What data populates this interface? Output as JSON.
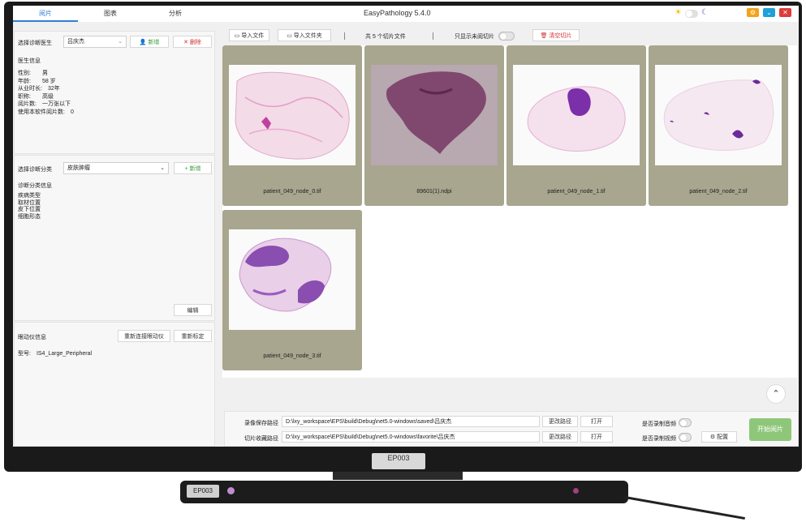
{
  "app": {
    "title": "EasyPathology 5.4.0",
    "tabs": [
      "阅片",
      "图表",
      "分析"
    ]
  },
  "doctor_panel": {
    "select_label": "选择诊断医生",
    "selected_doctor": "吕庆杰",
    "add_label": "新增",
    "delete_label": "删除",
    "section_title": "医生信息",
    "info_lines": [
      "性别:　　男",
      "年龄:　　58 岁",
      "从业时长:　32年",
      "职称:　　高级",
      "阅片数:　一万张以下",
      "使用本软件阅片数:　0"
    ]
  },
  "diagnosis_panel": {
    "select_label": "选择诊断分类",
    "selected_category": "皮肤肿瘤",
    "add_label": "+ 新增",
    "section_title": "诊断分类信息",
    "info_lines": [
      "疾病类型",
      "取材位置",
      "皮下位置",
      "细胞形态"
    ],
    "edit_label": "编辑"
  },
  "eye_tracker_panel": {
    "title": "眼动仪信息",
    "reconnect_label": "重新连接眼动仪",
    "recalibrate_label": "重新标定",
    "model_text": "型号:　IS4_Large_Peripheral"
  },
  "toolbar": {
    "import_file_label": "导入文件",
    "import_folder_label": "导入文件夹",
    "count_text": "共 5 个切片文件",
    "show_unread_label": "只显示未阅切片",
    "clear_label": "清空切片"
  },
  "slides": [
    {
      "name": "patient_049_node_0.tif",
      "color": "#d96fb3"
    },
    {
      "name": "89601(1).ndpi",
      "color": "#7a3c68"
    },
    {
      "name": "patient_049_node_1.tif",
      "color": "#7b2fa8"
    },
    {
      "name": "patient_049_node_2.tif",
      "color": "#6a2a9a"
    },
    {
      "name": "patient_049_node_3.tif",
      "color": "#8a4db0"
    }
  ],
  "bottom": {
    "record_path_label": "录像保存路径",
    "record_path_value": "D:\\lxy_workspace\\EPS\\build\\Debug\\net5.0-windows\\saved\\吕庆杰",
    "favorite_path_label": "切片收藏路径",
    "favorite_path_value": "D:\\lxy_workspace\\EPS\\build\\Debug\\net5.0-windows\\favorite\\吕庆杰",
    "change_path_label": "更改路径",
    "open_label": "打开",
    "record_audio_label": "是否录制音频",
    "record_video_label": "是否录制视频",
    "config_label": "配置",
    "start_label": "开始阅片"
  },
  "device": {
    "monitor_tag": "EP003",
    "bar_tag": "EP003"
  },
  "colors": {
    "accent": "#2f7fd6",
    "start_button": "#8fc77a",
    "card_bg": "#a8a68e"
  }
}
